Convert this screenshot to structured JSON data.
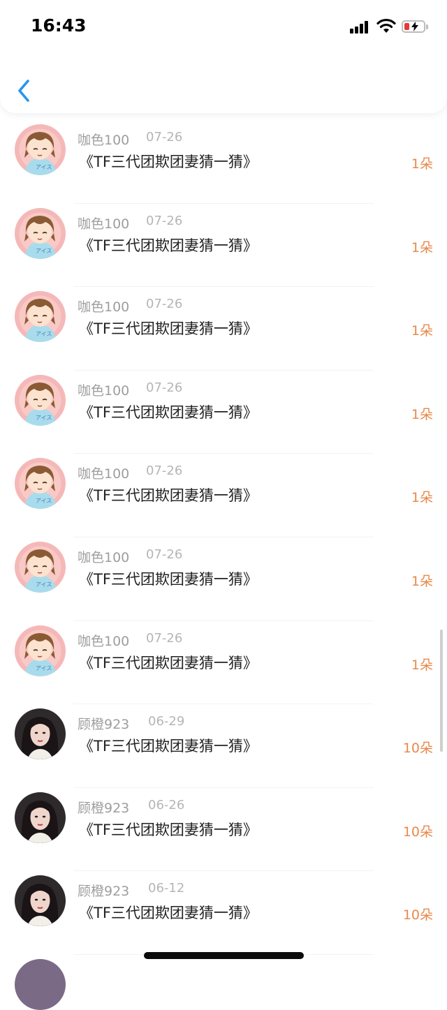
{
  "status_bar": {
    "time": "16:43"
  },
  "nav": {
    "back_icon": "chevron-left-icon",
    "accent": "#2196f3"
  },
  "colors": {
    "amount": "#e8894a",
    "name": "#9e9e9e",
    "date": "#b5b5b5"
  },
  "records": [
    {
      "name": "咖色100",
      "date": "07-26",
      "title": "《TF三代团欺团妻猜一猜》",
      "amount": "1朵",
      "avatar": "anime-girl-avatar"
    },
    {
      "name": "咖色100",
      "date": "07-26",
      "title": "《TF三代团欺团妻猜一猜》",
      "amount": "1朵",
      "avatar": "anime-girl-avatar"
    },
    {
      "name": "咖色100",
      "date": "07-26",
      "title": "《TF三代团欺团妻猜一猜》",
      "amount": "1朵",
      "avatar": "anime-girl-avatar"
    },
    {
      "name": "咖色100",
      "date": "07-26",
      "title": "《TF三代团欺团妻猜一猜》",
      "amount": "1朵",
      "avatar": "anime-girl-avatar"
    },
    {
      "name": "咖色100",
      "date": "07-26",
      "title": "《TF三代团欺团妻猜一猜》",
      "amount": "1朵",
      "avatar": "anime-girl-avatar"
    },
    {
      "name": "咖色100",
      "date": "07-26",
      "title": "《TF三代团欺团妻猜一猜》",
      "amount": "1朵",
      "avatar": "anime-girl-avatar"
    },
    {
      "name": "咖色100",
      "date": "07-26",
      "title": "《TF三代团欺团妻猜一猜》",
      "amount": "1朵",
      "avatar": "anime-girl-avatar"
    },
    {
      "name": "顾橙923",
      "date": "06-29",
      "title": "《TF三代团欺团妻猜一猜》",
      "amount": "10朵",
      "avatar": "portrait-avatar"
    },
    {
      "name": "顾橙923",
      "date": "06-26",
      "title": "《TF三代团欺团妻猜一猜》",
      "amount": "10朵",
      "avatar": "portrait-avatar"
    },
    {
      "name": "顾橙923",
      "date": "06-12",
      "title": "《TF三代团欺团妻猜一猜》",
      "amount": "10朵",
      "avatar": "portrait-avatar"
    }
  ]
}
